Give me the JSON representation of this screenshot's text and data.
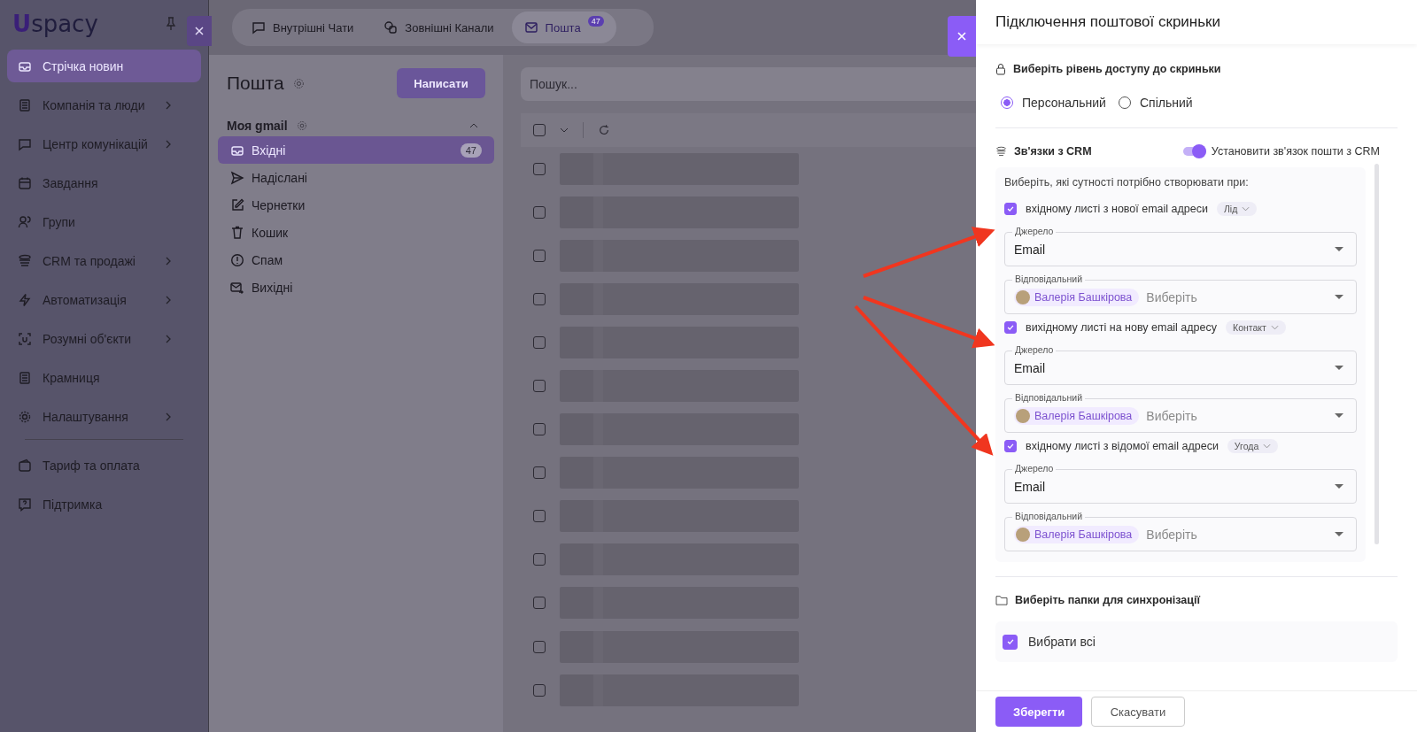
{
  "sidebar": {
    "logo_mark": "U",
    "logo": "spacy",
    "items": [
      {
        "label": "Стрічка новин",
        "has_children": false,
        "selected": true
      },
      {
        "label": "Компанія та люди",
        "has_children": true,
        "selected": false
      },
      {
        "label": "Центр комунікацій",
        "has_children": true,
        "selected": false
      },
      {
        "label": "Завдання",
        "has_children": false,
        "selected": false
      },
      {
        "label": "Групи",
        "has_children": false,
        "selected": false
      },
      {
        "label": "CRM та продажі",
        "has_children": true,
        "selected": false
      },
      {
        "label": "Автоматизація",
        "has_children": true,
        "selected": false
      },
      {
        "label": "Розумні об'єкти",
        "has_children": true,
        "selected": false
      },
      {
        "label": "Крамниця",
        "has_children": false,
        "selected": false
      },
      {
        "label": "Налаштування",
        "has_children": true,
        "selected": false
      },
      {
        "label": "Тариф та оплата",
        "has_children": false,
        "selected": false
      },
      {
        "label": "Підтримка",
        "has_children": false,
        "selected": false
      }
    ]
  },
  "top_tabs": [
    {
      "label": "Внутрішні Чати",
      "selected": false
    },
    {
      "label": "Зовнішні Канали",
      "selected": false
    },
    {
      "label": "Пошта",
      "selected": true,
      "badge": "47"
    }
  ],
  "mail": {
    "title": "Пошта",
    "compose_button": "Написати",
    "account": "Моя gmail",
    "folders": [
      {
        "label": "Вхідні",
        "selected": true,
        "count": "47"
      },
      {
        "label": "Надіслані",
        "selected": false
      },
      {
        "label": "Чернетки",
        "selected": false
      },
      {
        "label": "Кошик",
        "selected": false
      },
      {
        "label": "Спам",
        "selected": false
      },
      {
        "label": "Вихідні",
        "selected": false
      }
    ],
    "search": {
      "placeholder": "Пошук..."
    },
    "select_all_checked": false,
    "rows": [
      {
        "checked": false
      },
      {
        "checked": false
      },
      {
        "checked": false
      },
      {
        "checked": false
      },
      {
        "checked": false
      },
      {
        "checked": false
      },
      {
        "checked": false
      },
      {
        "checked": false
      },
      {
        "checked": false
      },
      {
        "checked": false
      },
      {
        "checked": false
      },
      {
        "checked": false
      },
      {
        "checked": false
      }
    ]
  },
  "drawer": {
    "title": "Підключення поштової скриньки",
    "access": {
      "title": "Виберіть рівень доступу до скриньки",
      "options": [
        {
          "label": "Персональний",
          "selected": true
        },
        {
          "label": "Спільний",
          "selected": false
        }
      ]
    },
    "crm": {
      "title": "Зв'язки з CRM",
      "toggle": {
        "label": "Установити зв'язок пошти з CRM",
        "on": true
      },
      "prompt": "Виберіть, які сутності потрібно створювати при:",
      "rules": [
        {
          "label": "вхідному листі з нової email адреси",
          "checked": true,
          "entity": "Лід",
          "source_label": "Джерело",
          "source": "Email",
          "responsible_label": "Відповідальний",
          "responsible": "Валерія Башкірова",
          "responsible_placeholder": "Виберіть"
        },
        {
          "label": "вихідному листі на нову email адресу",
          "checked": true,
          "entity": "Контакт",
          "source_label": "Джерело",
          "source": "Email",
          "responsible_label": "Відповідальний",
          "responsible": "Валерія Башкірова",
          "responsible_placeholder": "Виберіть"
        },
        {
          "label": "вхідному листі з відомої email адреси",
          "checked": true,
          "entity": "Угода",
          "source_label": "Джерело",
          "source": "Email",
          "responsible_label": "Відповідальний",
          "responsible": "Валерія Башкірова",
          "responsible_placeholder": "Виберіть"
        }
      ]
    },
    "folders": {
      "title": "Виберіть папки для синхронізації",
      "select_all": {
        "label": "Вибрати всі",
        "checked": true
      }
    },
    "buttons": [
      {
        "label": "Зберегти",
        "kind": "primary"
      },
      {
        "label": "Скасувати",
        "kind": "secondary"
      }
    ]
  }
}
